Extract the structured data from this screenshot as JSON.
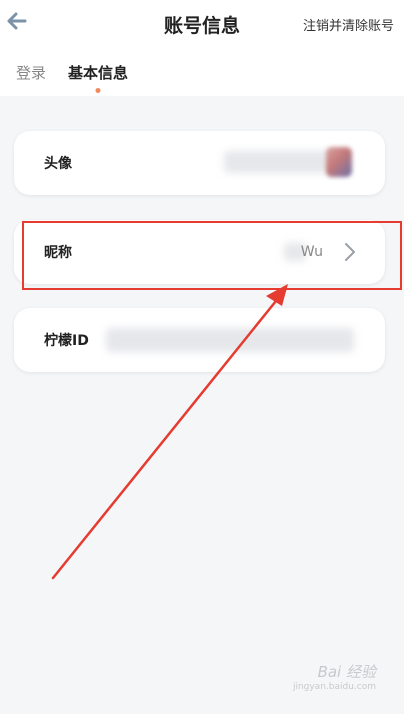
{
  "header": {
    "title": "账号信息",
    "clear_label": "注销并清除账号",
    "back_icon": "back-arrow-icon"
  },
  "tabs": [
    {
      "label": "登录",
      "active": false
    },
    {
      "label": "基本信息",
      "active": true
    }
  ],
  "rows": {
    "avatar": {
      "label": "头像"
    },
    "nickname": {
      "label": "昵称",
      "value_tail": "Wu"
    },
    "lemon_id": {
      "label": "柠檬ID"
    }
  },
  "annotation": {
    "color": "#e53b30"
  },
  "watermark": {
    "brand": "Bai 经验",
    "url": "jingyan.baidu.com"
  },
  "colors": {
    "accent_dot": "#f08a5d",
    "back_arrow": "#7a93a8"
  }
}
